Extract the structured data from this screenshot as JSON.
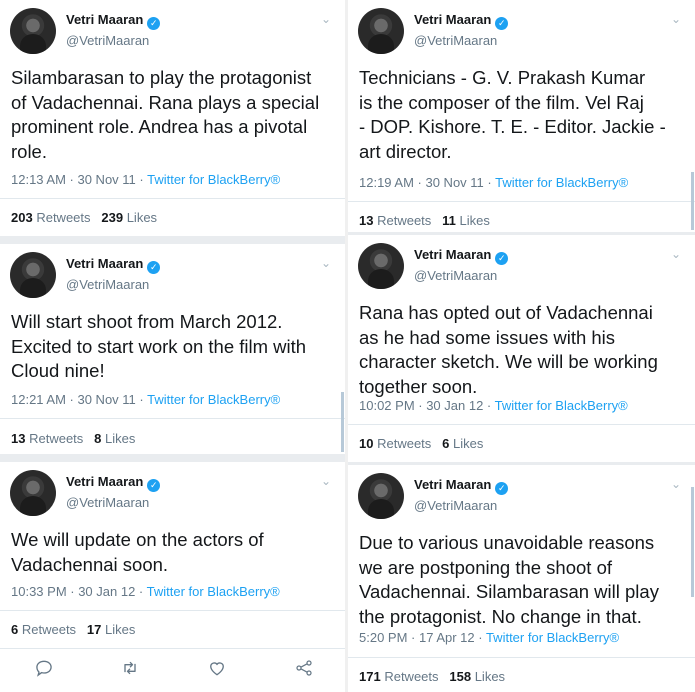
{
  "author": {
    "name": "Vetri Maaran",
    "handle": "@VetriMaaran"
  },
  "retweets_label": "Retweets",
  "likes_label": "Likes",
  "tweets": [
    {
      "text_lines": [
        "Silambarasan to play the protagonist",
        "of Vadachennai. Rana plays a special",
        "prominent role. Andrea has a pivotal",
        "role."
      ],
      "time": "12:13 AM · 30 Nov 11 · ",
      "source": "Twitter for BlackBerry®",
      "retweets": "203",
      "likes": "239"
    },
    {
      "text_lines": [
        "Technicians - G. V. Prakash Kumar",
        "is the composer of the film. Vel Raj",
        "- DOP. Kishore. T. E. - Editor. Jackie -",
        "art director."
      ],
      "time": "12:19 AM · 30 Nov 11 · ",
      "source": "Twitter for BlackBerry®",
      "retweets": "13",
      "likes": "11"
    },
    {
      "text_lines": [
        "Will start shoot from March 2012.",
        "Excited to start work on the film with",
        "Cloud nine!"
      ],
      "time": "12:21 AM · 30 Nov 11 · ",
      "source": "Twitter for BlackBerry®",
      "retweets": "13",
      "likes": "8"
    },
    {
      "text_lines": [
        "Rana has opted out of Vadachennai",
        "as he had some issues with his",
        "character sketch. We will be working",
        "together soon."
      ],
      "time": "10:02 PM · 30 Jan 12 · ",
      "source": "Twitter for BlackBerry®",
      "retweets": "10",
      "likes": "6"
    },
    {
      "text_lines": [
        "We will update on the actors of",
        "Vadachennai soon."
      ],
      "time": "10:33 PM · 30 Jan 12 · ",
      "source": "Twitter for BlackBerry®",
      "retweets": "6",
      "likes": "17"
    },
    {
      "text_lines": [
        "Due to various unavoidable reasons",
        "we are postponing the shoot of",
        "Vadachennai. Silambarasan will play",
        "the protagonist. No change in that."
      ],
      "time": "5:20 PM · 17 Apr 12 · ",
      "source": "Twitter for BlackBerry®",
      "retweets": "171",
      "likes": "158"
    }
  ],
  "actions": [
    "reply-icon",
    "retweet-icon",
    "like-icon",
    "share-icon"
  ]
}
